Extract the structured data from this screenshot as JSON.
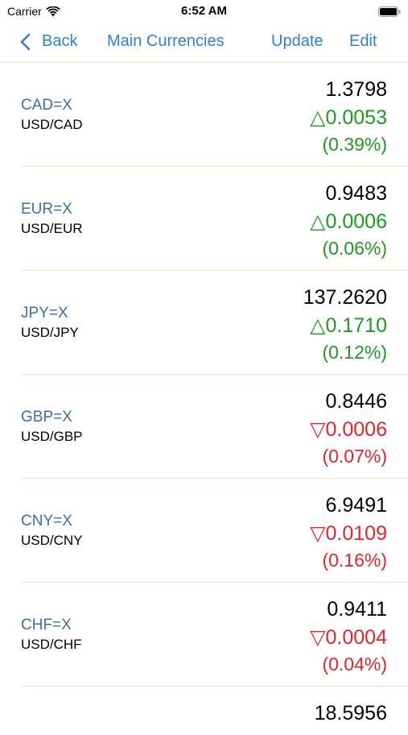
{
  "status": {
    "carrier": "Carrier",
    "time": "6:52 AM"
  },
  "nav": {
    "back_label": "Back",
    "title": "Main Currencies",
    "update_label": "Update",
    "edit_label": "Edit"
  },
  "colors": {
    "accent": "#2f7fd6",
    "symbol": "#3b6fa6",
    "up": "#1e9a1e",
    "down": "#e3242b",
    "separator": "#f5e6b8"
  },
  "rows": [
    {
      "symbol": "CAD=X",
      "pair": "USD/CAD",
      "price": "1.3798",
      "change": "△0.0053",
      "pct": "(0.39%)",
      "direction": "up"
    },
    {
      "symbol": "EUR=X",
      "pair": "USD/EUR",
      "price": "0.9483",
      "change": "△0.0006",
      "pct": "(0.06%)",
      "direction": "up"
    },
    {
      "symbol": "JPY=X",
      "pair": "USD/JPY",
      "price": "137.2620",
      "change": "△0.1710",
      "pct": "(0.12%)",
      "direction": "up"
    },
    {
      "symbol": "GBP=X",
      "pair": "USD/GBP",
      "price": "0.8446",
      "change": "▽0.0006",
      "pct": "(0.07%)",
      "direction": "down"
    },
    {
      "symbol": "CNY=X",
      "pair": "USD/CNY",
      "price": "6.9491",
      "change": "▽0.0109",
      "pct": "(0.16%)",
      "direction": "down"
    },
    {
      "symbol": "CHF=X",
      "pair": "USD/CHF",
      "price": "0.9411",
      "change": "▽0.0004",
      "pct": "(0.04%)",
      "direction": "down"
    },
    {
      "price": "18.5956"
    }
  ]
}
